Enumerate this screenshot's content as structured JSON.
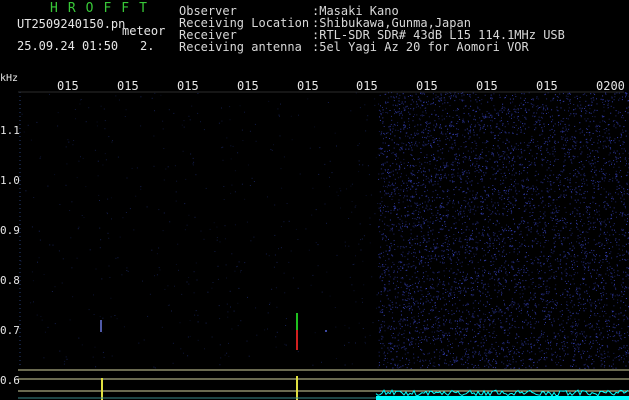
{
  "header": {
    "title": "HROFFT",
    "filename": "UT2509240150.pn",
    "meteor_label": "meteor",
    "datetime": "25.09.24 01:50",
    "meteor_count": "2."
  },
  "info": [
    {
      "label": "Observer",
      "value": ":Masaki Kano"
    },
    {
      "label": "Receiving Location",
      "value": ":Shibukawa,Gunma,Japan"
    },
    {
      "label": "Receiver",
      "value": ":RTL-SDR SDR# 43dB L15 114.1MHz USB"
    },
    {
      "label": "Receiving antenna",
      "value": ":5el Yagi Az 20 for Aomori VOR"
    }
  ],
  "spectrogram": {
    "freq_unit": "kHz",
    "freq_ticks": [
      "1.1",
      "1.0",
      "0.9",
      "0.8",
      "0.7",
      "0.6"
    ],
    "time_ticks": [
      "015",
      "015",
      "015",
      "015",
      "015",
      "015",
      "015",
      "015",
      "015",
      "0200"
    ],
    "colors": {
      "background": "#000000",
      "noise": "#3a46c8",
      "signal": "#e0e040",
      "trace": "#00ffff",
      "meteor_red": "#d02020",
      "meteor_green": "#20c020",
      "grid_line": "#d4d4a0"
    }
  }
}
